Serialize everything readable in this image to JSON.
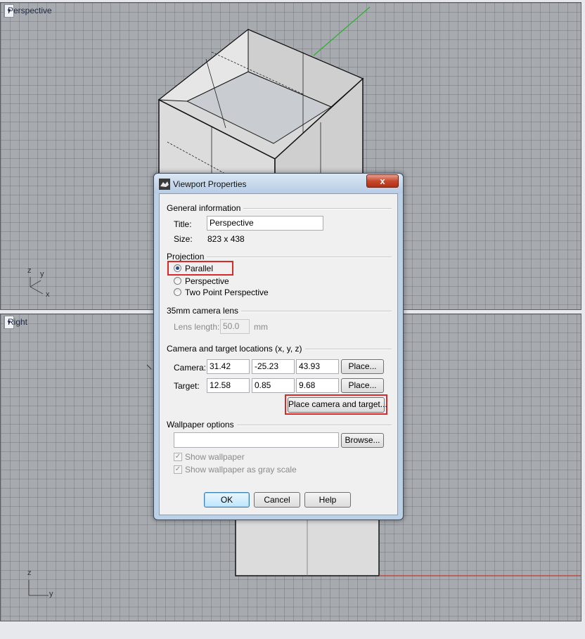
{
  "viewports": {
    "top": {
      "label": "Perspective"
    },
    "bottom": {
      "label": "Right"
    }
  },
  "axes": {
    "top": {
      "z": "z",
      "y": "y",
      "x": "x"
    },
    "bottom": {
      "z": "z",
      "y": "y"
    }
  },
  "dialog": {
    "title": "Viewport Properties",
    "close_label": "x",
    "general": {
      "heading": "General information",
      "title_label": "Title:",
      "title_value": "Perspective",
      "size_label": "Size:",
      "size_value": "823 x 438"
    },
    "projection": {
      "heading": "Projection",
      "options": [
        "Parallel",
        "Perspective",
        "Two Point Perspective"
      ],
      "selected": "Parallel"
    },
    "lens": {
      "heading": "35mm camera lens",
      "length_label": "Lens length:",
      "length_value": "50.0",
      "unit": "mm"
    },
    "camera": {
      "heading": "Camera and target locations (x, y, z)",
      "camera_label": "Camera:",
      "camera_values": [
        "31.42",
        "-25.23",
        "43.93"
      ],
      "target_label": "Target:",
      "target_values": [
        "12.58",
        "0.85",
        "9.68"
      ],
      "place_label": "Place...",
      "place_both_label": "Place camera and target..."
    },
    "wallpaper": {
      "heading": "Wallpaper options",
      "file_value": "",
      "browse_label": "Browse...",
      "show_label": "Show wallpaper",
      "gray_label": "Show wallpaper as gray scale"
    },
    "buttons": {
      "ok": "OK",
      "cancel": "Cancel",
      "help": "Help"
    }
  },
  "colors": {
    "highlight": "#d92a2a",
    "axis_green": "#2fae2f",
    "axis_red": "#c0392b"
  }
}
